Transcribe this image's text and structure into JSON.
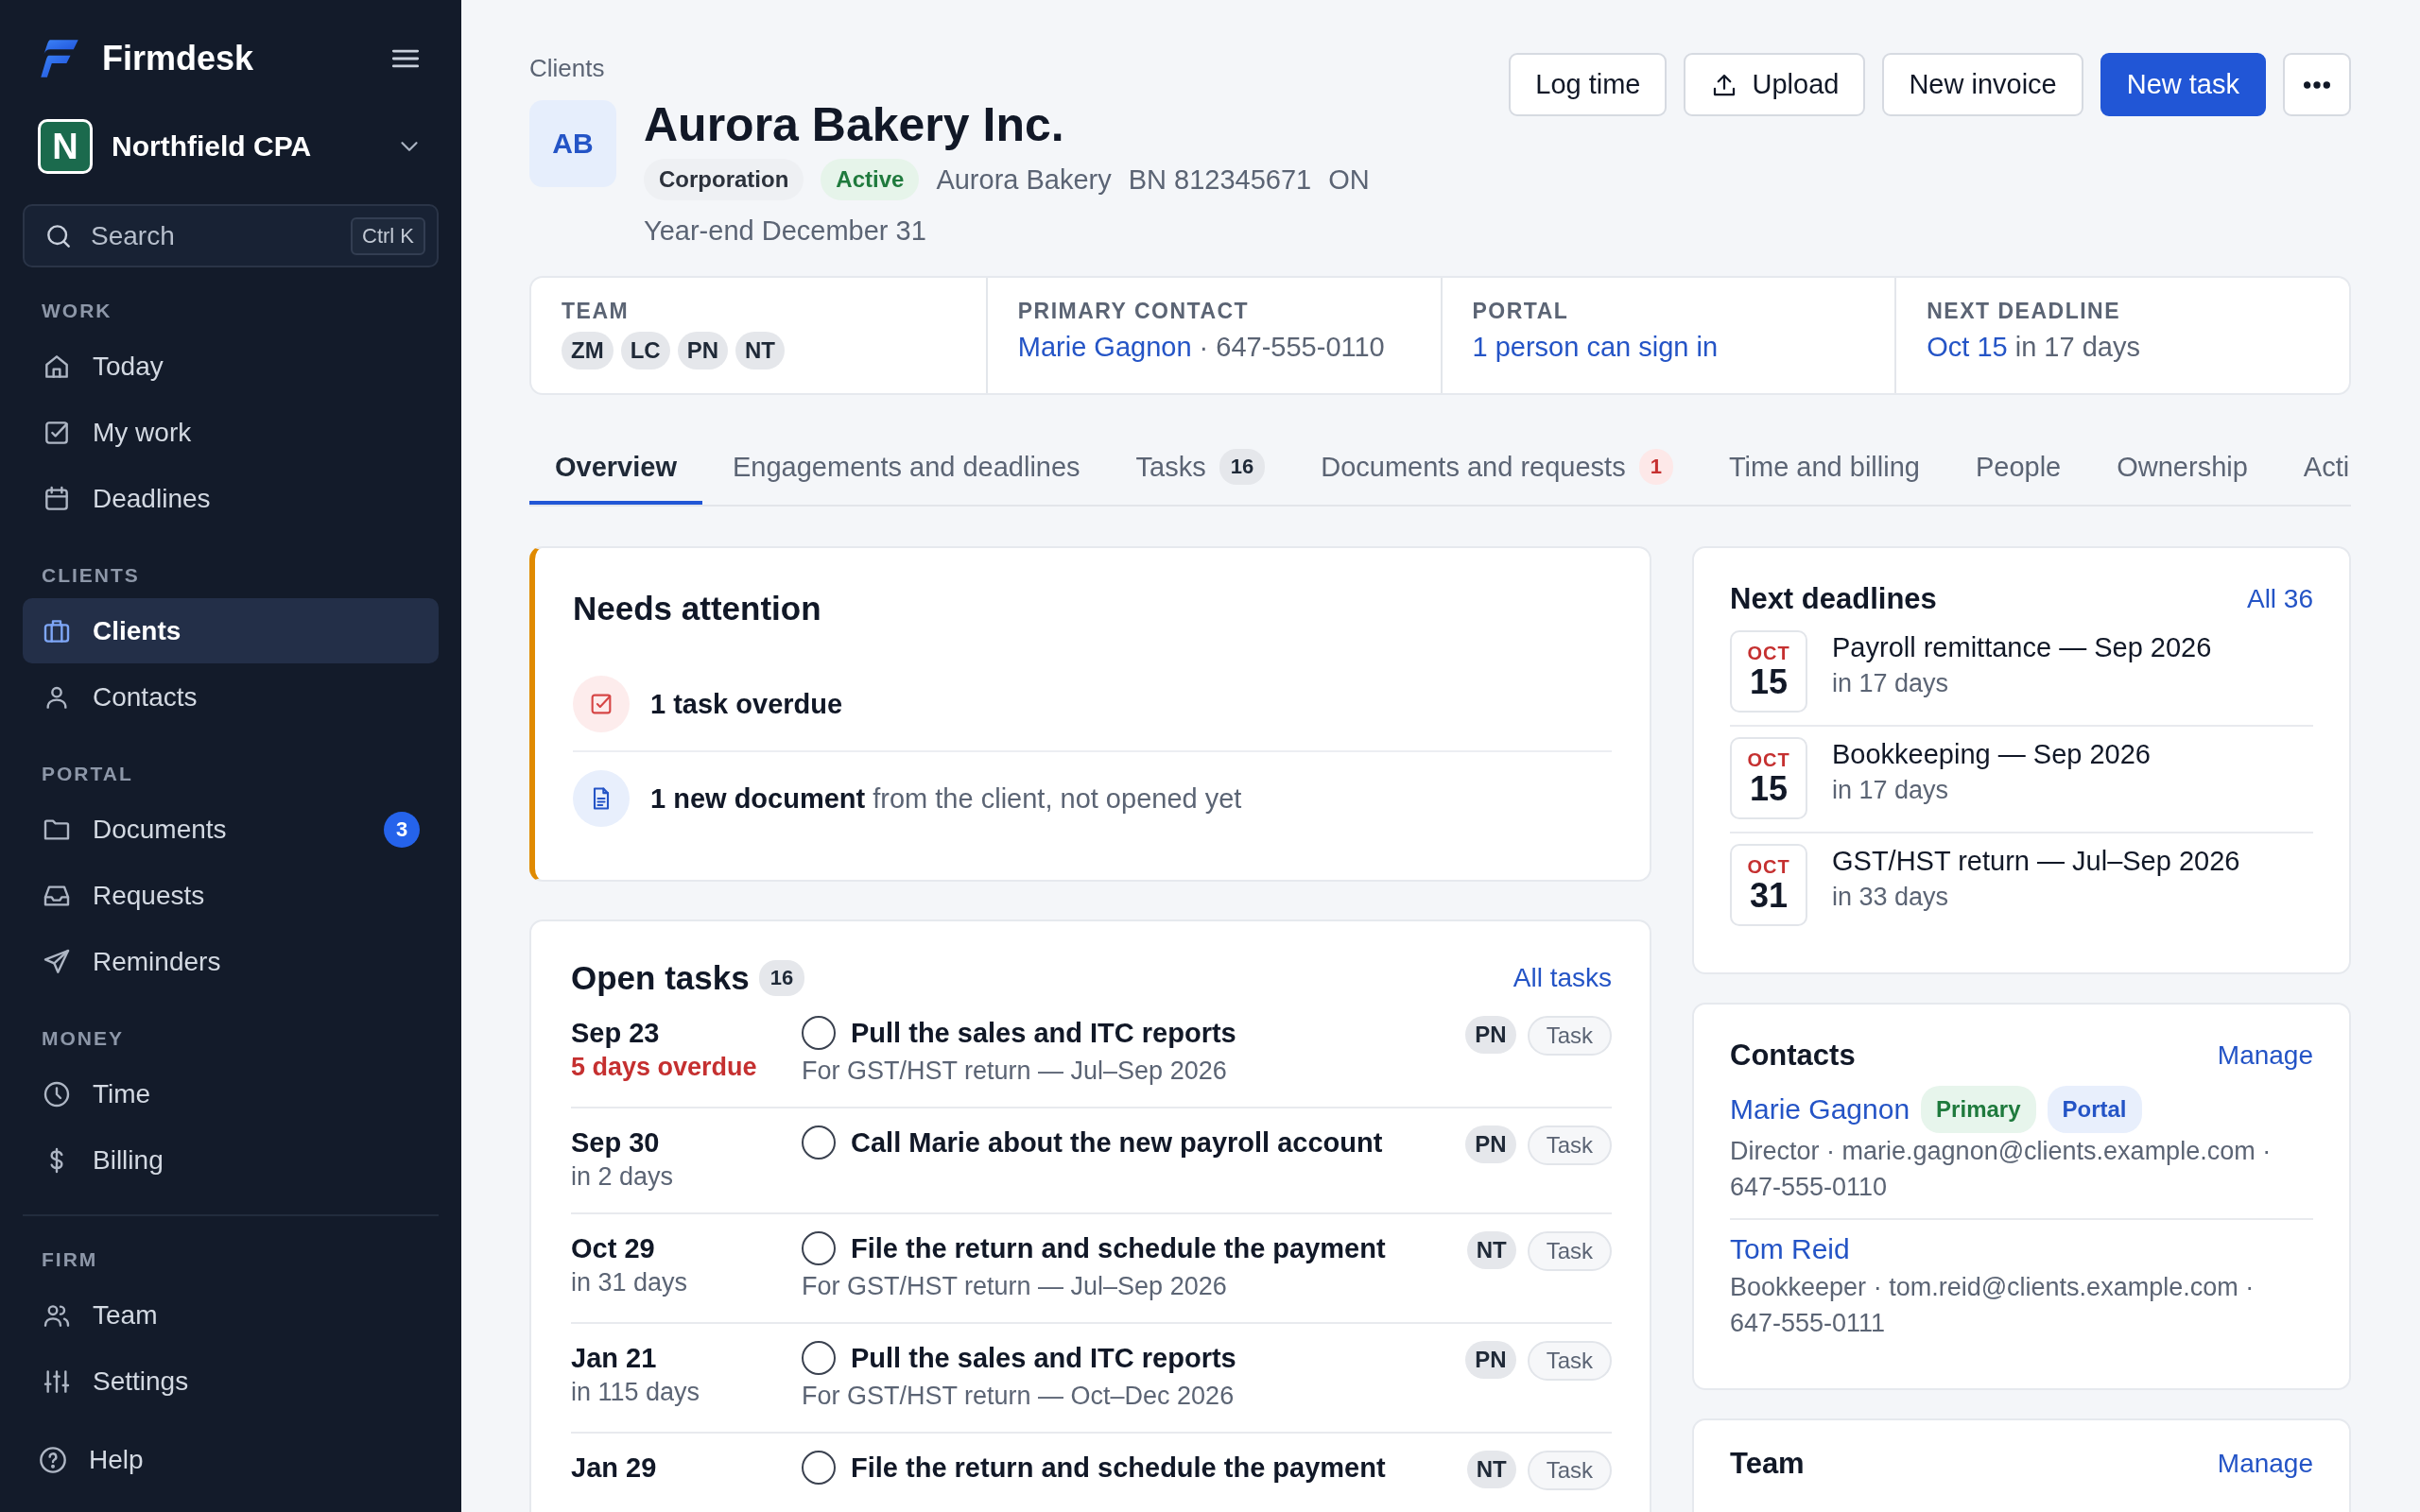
{
  "sidebar": {
    "brand": "Firmdesk",
    "firm": {
      "initial": "N",
      "name": "Northfield CPA"
    },
    "search": {
      "placeholder": "Search",
      "shortcut": "Ctrl K"
    },
    "sections": [
      {
        "label": "WORK",
        "items": [
          {
            "label": "Today",
            "selected": false
          },
          {
            "label": "My work",
            "selected": false
          },
          {
            "label": "Deadlines",
            "selected": false
          }
        ]
      },
      {
        "label": "CLIENTS",
        "items": [
          {
            "label": "Clients",
            "selected": true
          },
          {
            "label": "Contacts",
            "selected": false
          }
        ]
      },
      {
        "label": "PORTAL",
        "items": [
          {
            "label": "Documents",
            "badge": "3",
            "selected": false
          },
          {
            "label": "Requests",
            "selected": false
          },
          {
            "label": "Reminders",
            "selected": false
          }
        ]
      },
      {
        "label": "MONEY",
        "items": [
          {
            "label": "Time",
            "selected": false
          },
          {
            "label": "Billing",
            "selected": false
          }
        ]
      },
      {
        "label": "FIRM",
        "divider": true,
        "items": [
          {
            "label": "Team",
            "selected": false
          },
          {
            "label": "Settings",
            "selected": false
          }
        ]
      }
    ],
    "help": "Help"
  },
  "breadcrumb": "Clients",
  "client": {
    "initials": "AB",
    "name": "Aurora Bakery Inc.",
    "tags": [
      {
        "label": "Corporation",
        "kind": "neutral"
      },
      {
        "label": "Active",
        "kind": "success"
      }
    ],
    "meta": [
      "Aurora Bakery",
      "BN 812345671",
      "ON"
    ],
    "year_end": "Year-end December 31"
  },
  "actions": [
    {
      "label": "Log time",
      "kind": "secondary"
    },
    {
      "label": "Upload",
      "kind": "upload"
    },
    {
      "label": "New invoice",
      "kind": "secondary"
    },
    {
      "label": "New task",
      "kind": "primary"
    },
    {
      "kind": "more"
    }
  ],
  "summary": [
    {
      "label": "TEAM",
      "members": [
        "ZM",
        "LC",
        "PN",
        "NT"
      ]
    },
    {
      "label": "PRIMARY CONTACT",
      "link": "Marie Gagnon",
      "text": "· 647-555-0110"
    },
    {
      "label": "PORTAL",
      "link": "1 person can sign in"
    },
    {
      "label": "NEXT DEADLINE",
      "link": "Oct 15",
      "text": "in 17 days"
    }
  ],
  "tabs": [
    {
      "label": "Overview",
      "selected": true
    },
    {
      "label": "Engagements and deadlines",
      "selected": false
    },
    {
      "label": "Tasks",
      "count": {
        "text": "16",
        "alert": false
      },
      "selected": false
    },
    {
      "label": "Documents and requests",
      "count": {
        "text": "1",
        "alert": true
      },
      "selected": false
    },
    {
      "label": "Time and billing",
      "selected": false
    },
    {
      "label": "People",
      "selected": false
    },
    {
      "label": "Ownership",
      "selected": false
    },
    {
      "label": "Acti",
      "selected": false
    }
  ],
  "attention": {
    "title": "Needs attention",
    "items": [
      {
        "kind": "task",
        "strong": "1 task overdue"
      },
      {
        "kind": "document",
        "strong": "1 new document",
        "rest": "from the client, not opened yet"
      }
    ]
  },
  "open_tasks": {
    "title": "Open tasks",
    "count": "16",
    "link": "All tasks",
    "rows": [
      {
        "date": "Sep 23",
        "due": "5 days overdue",
        "overdue": true,
        "checked": false,
        "title": "Pull the sales and ITC reports",
        "subtitle": "For GST/HST return — Jul–Sep 2026",
        "assignee": "PN",
        "type": "Task"
      },
      {
        "date": "Sep 30",
        "due": "in 2 days",
        "overdue": false,
        "checked": false,
        "title": "Call Marie about the new payroll account",
        "assignee": "PN",
        "type": "Task"
      },
      {
        "date": "Oct 29",
        "due": "in 31 days",
        "overdue": false,
        "checked": false,
        "title": "File the return and schedule the payment",
        "subtitle": "For GST/HST return — Jul–Sep 2026",
        "assignee": "NT",
        "type": "Task"
      },
      {
        "date": "Jan 21",
        "due": "in 115 days",
        "overdue": false,
        "checked": false,
        "title": "Pull the sales and ITC reports",
        "subtitle": "For GST/HST return — Oct–Dec 2026",
        "assignee": "PN",
        "type": "Task"
      },
      {
        "date": "Jan 29",
        "checked": false,
        "title": "File the return and schedule the payment",
        "assignee": "NT",
        "type": "Task"
      }
    ]
  },
  "deadlines": {
    "title": "Next deadlines",
    "link": "All 36",
    "items": [
      {
        "month": "OCT",
        "day": "15",
        "title": "Payroll remittance — Sep 2026",
        "due": "in 17 days"
      },
      {
        "month": "OCT",
        "day": "15",
        "title": "Bookkeeping — Sep 2026",
        "due": "in 17 days"
      },
      {
        "month": "OCT",
        "day": "31",
        "title": "GST/HST return — Jul–Sep 2026",
        "due": "in 33 days"
      }
    ]
  },
  "contacts": {
    "title": "Contacts",
    "link": "Manage",
    "items": [
      {
        "name": "Marie Gagnon",
        "tags": [
          {
            "label": "Primary",
            "kind": "primary"
          },
          {
            "label": "Portal",
            "kind": "portal"
          }
        ],
        "details": "Director · marie.gagnon@clients.example.com · 647-555-0110"
      },
      {
        "name": "Tom Reid",
        "details": "Bookkeeper · tom.reid@clients.example.com · 647-555-0111"
      }
    ]
  },
  "team_card": {
    "title": "Team",
    "link": "Manage"
  }
}
